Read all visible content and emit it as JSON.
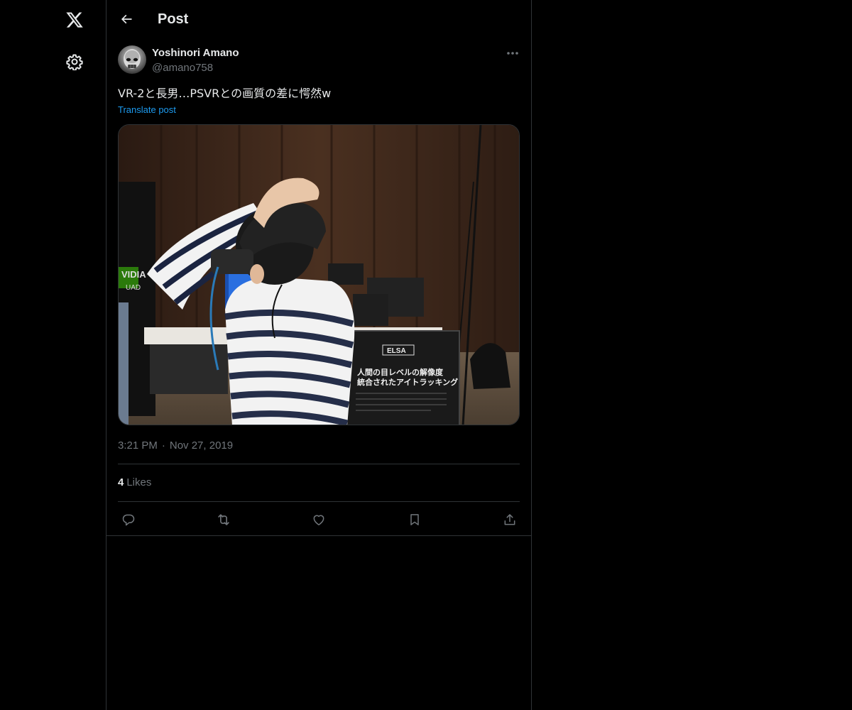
{
  "header": {
    "title": "Post",
    "back_icon": "arrow-left-icon"
  },
  "nav": {
    "logo_icon": "x-logo-icon",
    "settings_icon": "gear-icon"
  },
  "post": {
    "author_name": "Yoshinori Amano",
    "author_handle": "@amano758",
    "text": "VR-2と長男…PSVRとの画質の差に愕然w",
    "translate_label": "Translate post",
    "time": "3:21 PM",
    "date_separator": "·",
    "date": "Nov 27, 2019",
    "likes_count": "4",
    "likes_label": "Likes",
    "media_sign_logo": "ELSA",
    "media_sign_line1": "人間の目レベルの解像度",
    "media_sign_line2": "統合されたアイトラッキング",
    "media_banner_text": "VIDIA",
    "media_banner_text2": "UAD",
    "actions": [
      "reply-icon",
      "repost-icon",
      "heart-icon",
      "bookmark-icon",
      "share-icon"
    ]
  },
  "colors": {
    "background": "#000000",
    "border": "#2f3336",
    "text_primary": "#e7e9ea",
    "text_secondary": "#71767b",
    "link": "#1d9bf0"
  }
}
